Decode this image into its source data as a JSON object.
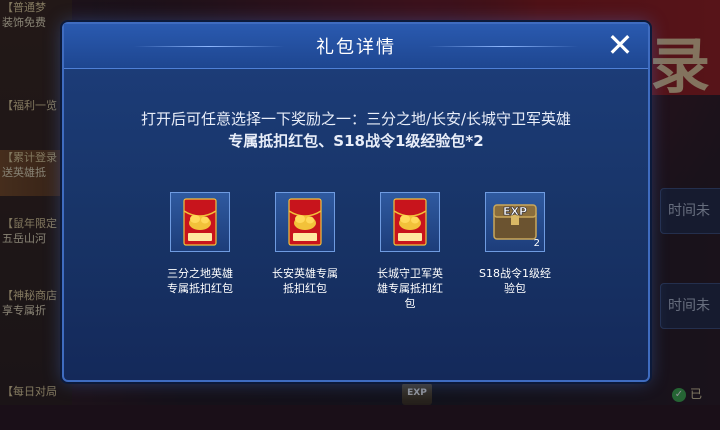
{
  "background": {
    "left_items": [
      {
        "line1": "【普通梦",
        "line2": "装饰免费"
      },
      {
        "line1": "【福利一览",
        "line2": ""
      },
      {
        "line1": "【累计登录",
        "line2": "送英雄抵"
      },
      {
        "line1": "【鼠年限定",
        "line2": "五岳山河"
      },
      {
        "line1": "【神秘商店",
        "line2": "享专属折"
      },
      {
        "line1": "【每日对局",
        "line2": ""
      }
    ],
    "right_big_char": "录",
    "right_times": [
      "时间未",
      "时间未"
    ],
    "claimed_label": "已"
  },
  "modal": {
    "title": "礼包详情",
    "description_line1": "打开后可任意选择一下奖励之一：三分之地/长安/长城守卫军英雄",
    "description_line2": "专属抵扣红包、S18战令1级经验包*2",
    "rewards": [
      {
        "icon": "red-envelope-icon",
        "label": "三分之地英雄专属抵扣红包"
      },
      {
        "icon": "red-envelope-icon",
        "label": "长安英雄专属抵扣红包"
      },
      {
        "icon": "red-envelope-icon",
        "label": "长城守卫军英雄专属抵扣红包"
      },
      {
        "icon": "exp-chest-icon",
        "label": "S18战令1级经验包",
        "count": "2",
        "badge_text": "EXP"
      }
    ]
  },
  "colors": {
    "modal_bg": "#183467",
    "modal_border": "#3f6cc0",
    "envelope_red": "#c8141c",
    "envelope_gold": "#f2c23a"
  }
}
